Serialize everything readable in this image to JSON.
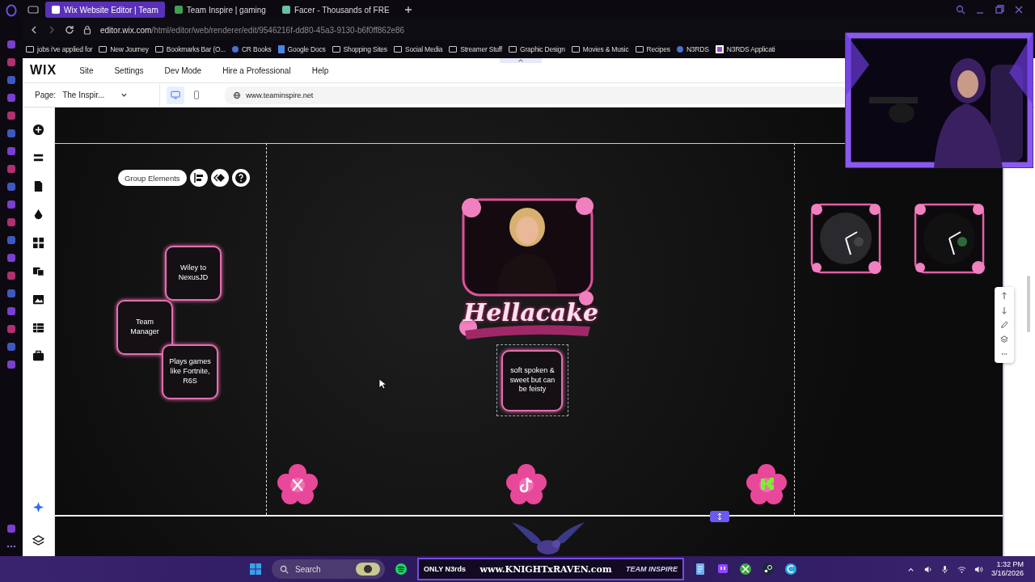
{
  "browser": {
    "tabs": [
      {
        "label": "Wix Website Editor | Team",
        "selected": true
      },
      {
        "label": "Team Inspire | gaming",
        "selected": false
      },
      {
        "label": "Facer - Thousands of FRE",
        "selected": false
      }
    ],
    "url_host": "editor.wix.com",
    "url_path": "/html/editor/web/renderer/edit/9546216f-dd80-45a3-9130-b6f0ff862e86",
    "bookmarks": [
      {
        "label": "jobs i've applied for",
        "kind": "folder"
      },
      {
        "label": "New Journey",
        "kind": "folder"
      },
      {
        "label": "Bookmarks Bar (O...",
        "kind": "folder"
      },
      {
        "label": "CR Books",
        "kind": "site"
      },
      {
        "label": "Google Docs",
        "kind": "docs"
      },
      {
        "label": "Shopping Sites",
        "kind": "folder"
      },
      {
        "label": "Social Media",
        "kind": "folder"
      },
      {
        "label": "Streamer Stuff",
        "kind": "folder"
      },
      {
        "label": "Graphic Design",
        "kind": "folder"
      },
      {
        "label": "Movies & Music",
        "kind": "folder"
      },
      {
        "label": "Recipes",
        "kind": "folder"
      },
      {
        "label": "N3RDS",
        "kind": "site"
      },
      {
        "label": "N3RDS Applicati",
        "kind": "app"
      }
    ]
  },
  "editor": {
    "logo": "WIX",
    "menu": [
      "Site",
      "Settings",
      "Dev Mode",
      "Hire a Professional",
      "Help"
    ],
    "page_label": "Page:",
    "page_value": "The Inspir...",
    "views": [
      {
        "kind": "desktop",
        "selected": true
      },
      {
        "kind": "mobile",
        "selected": false
      }
    ],
    "site_url": "www.teaminspire.net"
  },
  "canvas": {
    "toolbar_label": "Group Elements",
    "role_frames": [
      "Wiley to NexusJD",
      "Team Manager",
      "Plays games like Fortnite, R6S"
    ],
    "profile": {
      "name": "Hellacake",
      "caption": "soft spoken & sweet but can be feisty"
    },
    "social": [
      {
        "kind": "x"
      },
      {
        "kind": "tiktok"
      },
      {
        "kind": "kick"
      }
    ]
  },
  "taskbar": {
    "search_placeholder": "Search",
    "banners": [
      "ONLY N3rds",
      "www.KNIGHTxRAVEN.com",
      "TEAM INSPIRE"
    ],
    "time": "1:32 PM",
    "date": "3/16/2026"
  }
}
